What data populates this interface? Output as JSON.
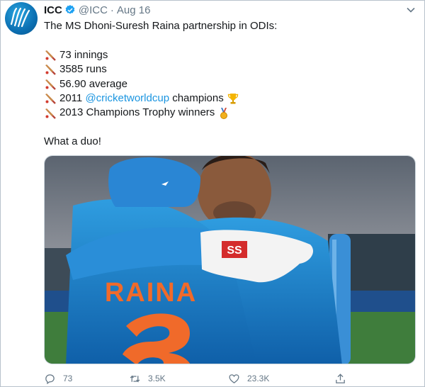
{
  "tweet": {
    "author_name": "ICC",
    "handle": "@ICC",
    "separator": "·",
    "date": "Aug 16",
    "intro": "The MS Dhoni-Suresh Raina partnership in ODIs:",
    "stats": [
      {
        "text": "73 innings"
      },
      {
        "text": "3585 runs"
      },
      {
        "text": "56.90 average"
      },
      {
        "prefix": "2011 ",
        "link": "@cricketworldcup",
        "suffix": " champions",
        "emoji": "trophy"
      },
      {
        "text": "2013 Champions Trophy winners",
        "emoji": "medal"
      }
    ],
    "closing": "What a duo!",
    "bullet_icon": "cricket-bat-icon",
    "image": {
      "jersey_text": "RAINA",
      "glove_brand": "SS"
    }
  },
  "actions": {
    "reply_count": "73",
    "retweet_count": "3.5K",
    "like_count": "23.3K"
  },
  "colors": {
    "link": "#1b95e0",
    "muted": "#657786",
    "verified": "#1da1f2"
  }
}
